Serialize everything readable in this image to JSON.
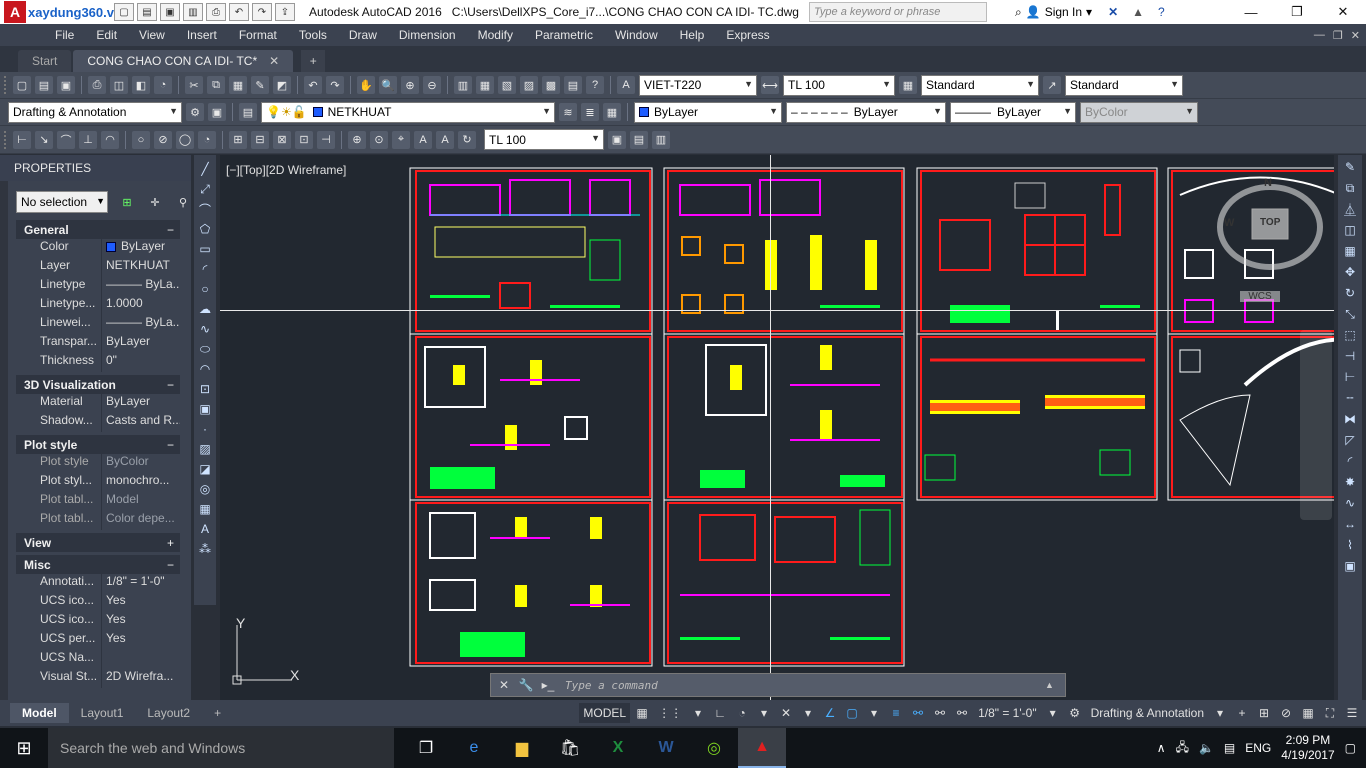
{
  "titlebar": {
    "watermark": "xaydung360.vn",
    "app_name": "Autodesk AutoCAD 2016",
    "file_path": "C:\\Users\\DellXPS_Core_i7...\\CONG CHAO CON CA IDI- TC.dwg",
    "search_placeholder": "Type a keyword or phrase",
    "signin_label": "Sign In"
  },
  "menu": [
    "File",
    "Edit",
    "View",
    "Insert",
    "Format",
    "Tools",
    "Draw",
    "Dimension",
    "Modify",
    "Parametric",
    "Window",
    "Help",
    "Express"
  ],
  "tabs": {
    "start_label": "Start",
    "doc_label": "CONG CHAO CON CA IDI- TC*"
  },
  "toolbar1": {
    "text_style": "VIET-T220",
    "dim_style": "TL 100",
    "table_style": "Standard",
    "mleader_style": "Standard"
  },
  "toolbar2": {
    "workspace": "Drafting & Annotation",
    "layer": "NETKHUAT",
    "color": "ByLayer",
    "linetype": "ByLayer",
    "lineweight": "ByLayer",
    "plotstyle": "ByColor"
  },
  "toolbar3": {
    "dim_style": "TL 100"
  },
  "properties": {
    "title": "PROPERTIES",
    "selection": "No selection",
    "sections": [
      {
        "name": "General",
        "toggle": "−",
        "rows": [
          {
            "k": "Color",
            "v": "ByLayer",
            "dim": false
          },
          {
            "k": "Layer",
            "v": "NETKHUAT",
            "dim": false
          },
          {
            "k": "Linetype",
            "v": "——— ByLa...",
            "dim": false
          },
          {
            "k": "Linetype...",
            "v": "1.0000",
            "dim": false
          },
          {
            "k": "Linewei...",
            "v": "——— ByLa...",
            "dim": false
          },
          {
            "k": "Transpar...",
            "v": "ByLayer",
            "dim": false
          },
          {
            "k": "Thickness",
            "v": "0\"",
            "dim": false
          }
        ]
      },
      {
        "name": "3D Visualization",
        "toggle": "−",
        "rows": [
          {
            "k": "Material",
            "v": "ByLayer",
            "dim": false
          },
          {
            "k": "Shadow...",
            "v": "Casts and R...",
            "dim": false
          }
        ]
      },
      {
        "name": "Plot style",
        "toggle": "−",
        "rows": [
          {
            "k": "Plot style",
            "v": "ByColor",
            "dim": true
          },
          {
            "k": "Plot styl...",
            "v": "monochro...",
            "dim": false
          },
          {
            "k": "Plot tabl...",
            "v": "Model",
            "dim": true
          },
          {
            "k": "Plot tabl...",
            "v": "Color depe...",
            "dim": true
          }
        ]
      },
      {
        "name": "View",
        "toggle": "+",
        "rows": []
      },
      {
        "name": "Misc",
        "toggle": "−",
        "rows": [
          {
            "k": "Annotati...",
            "v": "1/8\" = 1'-0\"",
            "dim": false
          },
          {
            "k": "UCS ico...",
            "v": "Yes",
            "dim": false
          },
          {
            "k": "UCS ico...",
            "v": "Yes",
            "dim": false
          },
          {
            "k": "UCS per...",
            "v": "Yes",
            "dim": false
          },
          {
            "k": "UCS Na...",
            "v": "",
            "dim": false
          },
          {
            "k": "Visual St...",
            "v": "2D Wirefra...",
            "dim": false
          }
        ]
      }
    ]
  },
  "viewport": {
    "label": "[−][Top][2D Wireframe]",
    "viewcube_top": "TOP",
    "viewcube_n": "N",
    "viewcube_w": "W",
    "wcs": "WCS",
    "ucs_x": "X",
    "ucs_y": "Y"
  },
  "commandline": {
    "placeholder": "Type a command"
  },
  "layout_tabs": [
    "Model",
    "Layout1",
    "Layout2"
  ],
  "status": {
    "model": "MODEL",
    "scale": "1/8\" = 1'-0\"",
    "workspace": "Drafting & Annotation"
  },
  "taskbar": {
    "search": "Search the web and Windows",
    "language": "ENG",
    "time": "2:09 PM",
    "date": "4/19/2017"
  },
  "colors": {
    "drawing_border": "#ff1b1b",
    "canvas": "#222830",
    "accent_green": "#00ff3c",
    "accent_yellow": "#ffff00",
    "accent_magenta": "#ff00ff"
  }
}
